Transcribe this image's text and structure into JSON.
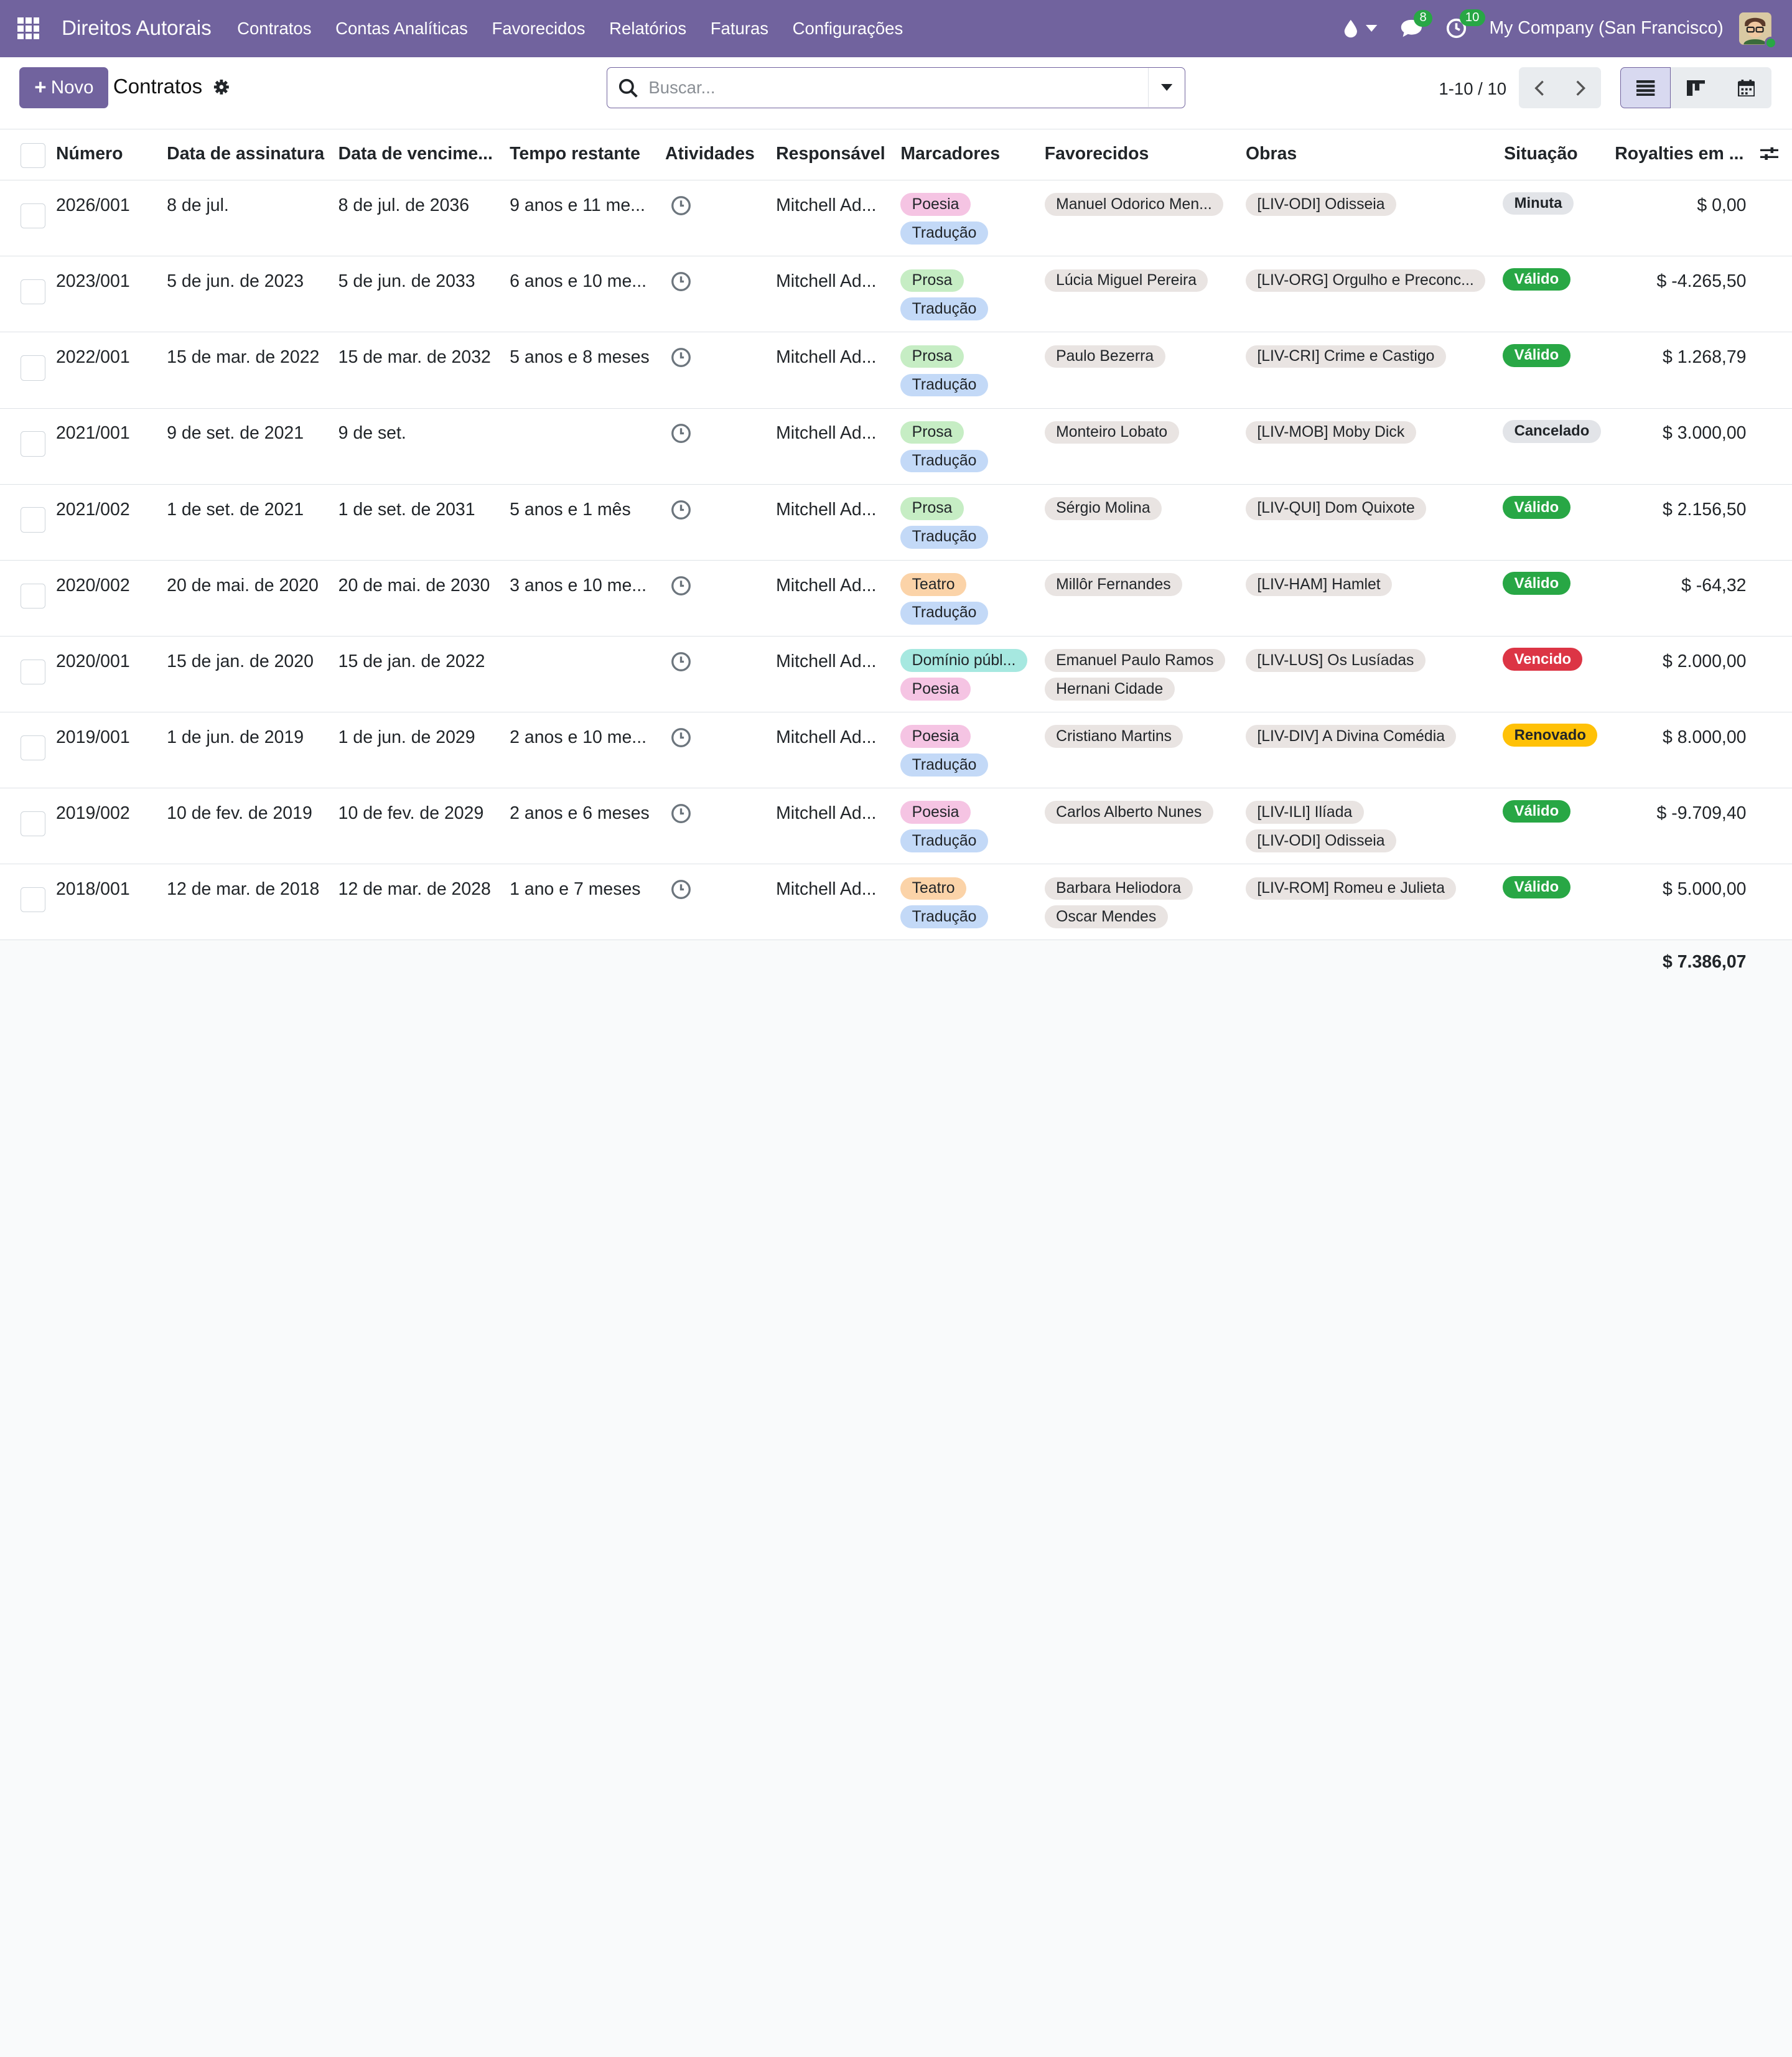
{
  "navbar": {
    "app_name": "Direitos Autorais",
    "menu": [
      "Contratos",
      "Contas Analíticas",
      "Favorecidos",
      "Relatórios",
      "Faturas",
      "Configurações"
    ],
    "messages_count": "8",
    "activities_count": "10",
    "company": "My Company (San Francisco)"
  },
  "control": {
    "new_label": "Novo",
    "title": "Contratos",
    "search_placeholder": "Buscar...",
    "pager": "1-10 / 10"
  },
  "columns": [
    "Número",
    "Data de assinatura",
    "Data de vencime...",
    "Tempo restante",
    "Atividades",
    "Responsável",
    "Marcadores",
    "Favorecidos",
    "Obras",
    "Situação",
    "Royalties em ..."
  ],
  "rows": [
    {
      "numero": "2026/001",
      "assinatura": "8 de jul.",
      "vencimento": "8 de jul. de 2036",
      "tempo": "9 anos e 11 me...",
      "responsavel": "Mitchell Ad...",
      "marcadores": [
        "Poesia",
        "Tradução"
      ],
      "favorecidos": [
        "Manuel Odorico Men..."
      ],
      "obras": [
        "[LIV-ODI] Odisseia"
      ],
      "situacao": "Minuta",
      "royalties": "$ 0,00"
    },
    {
      "numero": "2023/001",
      "assinatura": "5 de jun. de 2023",
      "vencimento": "5 de jun. de 2033",
      "tempo": "6 anos e 10 me...",
      "responsavel": "Mitchell Ad...",
      "marcadores": [
        "Prosa",
        "Tradução"
      ],
      "favorecidos": [
        "Lúcia Miguel Pereira"
      ],
      "obras": [
        "[LIV-ORG] Orgulho e Preconc..."
      ],
      "situacao": "Válido",
      "royalties": "$ -4.265,50"
    },
    {
      "numero": "2022/001",
      "assinatura": "15 de mar. de 2022",
      "vencimento": "15 de mar. de 2032",
      "tempo": "5 anos e 8 meses",
      "responsavel": "Mitchell Ad...",
      "marcadores": [
        "Prosa",
        "Tradução"
      ],
      "favorecidos": [
        "Paulo Bezerra"
      ],
      "obras": [
        "[LIV-CRI] Crime e Castigo"
      ],
      "situacao": "Válido",
      "royalties": "$ 1.268,79"
    },
    {
      "numero": "2021/001",
      "assinatura": "9 de set. de 2021",
      "vencimento": "9 de set.",
      "tempo": "",
      "responsavel": "Mitchell Ad...",
      "marcadores": [
        "Prosa",
        "Tradução"
      ],
      "favorecidos": [
        "Monteiro Lobato"
      ],
      "obras": [
        "[LIV-MOB] Moby Dick"
      ],
      "situacao": "Cancelado",
      "royalties": "$ 3.000,00"
    },
    {
      "numero": "2021/002",
      "assinatura": "1 de set. de 2021",
      "vencimento": "1 de set. de 2031",
      "tempo": "5 anos e 1 mês",
      "responsavel": "Mitchell Ad...",
      "marcadores": [
        "Prosa",
        "Tradução"
      ],
      "favorecidos": [
        "Sérgio Molina"
      ],
      "obras": [
        "[LIV-QUI] Dom Quixote"
      ],
      "situacao": "Válido",
      "royalties": "$ 2.156,50"
    },
    {
      "numero": "2020/002",
      "assinatura": "20 de mai. de 2020",
      "vencimento": "20 de mai. de 2030",
      "tempo": "3 anos e 10 me...",
      "responsavel": "Mitchell Ad...",
      "marcadores": [
        "Teatro",
        "Tradução"
      ],
      "favorecidos": [
        "Millôr Fernandes"
      ],
      "obras": [
        "[LIV-HAM] Hamlet"
      ],
      "situacao": "Válido",
      "royalties": "$ -64,32"
    },
    {
      "numero": "2020/001",
      "assinatura": "15 de jan. de 2020",
      "vencimento": "15 de jan. de 2022",
      "tempo": "",
      "responsavel": "Mitchell Ad...",
      "marcadores": [
        "Domínio públ...",
        "Poesia"
      ],
      "favorecidos": [
        "Emanuel Paulo Ramos",
        "Hernani Cidade"
      ],
      "obras": [
        "[LIV-LUS] Os Lusíadas"
      ],
      "situacao": "Vencido",
      "royalties": "$ 2.000,00"
    },
    {
      "numero": "2019/001",
      "assinatura": "1 de jun. de 2019",
      "vencimento": "1 de jun. de 2029",
      "tempo": "2 anos e 10 me...",
      "responsavel": "Mitchell Ad...",
      "marcadores": [
        "Poesia",
        "Tradução"
      ],
      "favorecidos": [
        "Cristiano Martins"
      ],
      "obras": [
        "[LIV-DIV] A Divina Comédia"
      ],
      "situacao": "Renovado",
      "royalties": "$ 8.000,00"
    },
    {
      "numero": "2019/002",
      "assinatura": "10 de fev. de 2019",
      "vencimento": "10 de fev. de 2029",
      "tempo": "2 anos e 6 meses",
      "responsavel": "Mitchell Ad...",
      "marcadores": [
        "Poesia",
        "Tradução"
      ],
      "favorecidos": [
        "Carlos Alberto Nunes"
      ],
      "obras": [
        "[LIV-ILI] Ilíada",
        "[LIV-ODI] Odisseia"
      ],
      "situacao": "Válido",
      "royalties": "$ -9.709,40"
    },
    {
      "numero": "2018/001",
      "assinatura": "12 de mar. de 2018",
      "vencimento": "12 de mar. de 2028",
      "tempo": "1 ano e 7 meses",
      "responsavel": "Mitchell Ad...",
      "marcadores": [
        "Teatro",
        "Tradução"
      ],
      "favorecidos": [
        "Barbara Heliodora",
        "Oscar Mendes"
      ],
      "obras": [
        "[LIV-ROM] Romeu e Julieta"
      ],
      "situacao": "Válido",
      "royalties": "$ 5.000,00"
    }
  ],
  "total": "$ 7.386,07",
  "colors": {
    "brand": "#71639e",
    "tag_poesia": "#f5c4e3",
    "tag_traducao": "#c3d9f7",
    "tag_prosa": "#c6edc4",
    "tag_teatro": "#fbd3a8",
    "tag_dominio": "#a6e8e0",
    "tag_neutral": "#e9e4e2",
    "status_valido": "#28a745",
    "status_minuta": "#e2e4e8",
    "status_cancelado": "#e2e4e8",
    "status_vencido": "#dc3545",
    "status_renovado": "#ffc107"
  },
  "icons": [
    "apps-grid-icon",
    "drop-icon",
    "chat-icon",
    "clock-icon",
    "gear-icon",
    "search-icon",
    "caret-down-icon",
    "chevron-left-icon",
    "chevron-right-icon",
    "list-view-icon",
    "kanban-view-icon",
    "calendar-view-icon",
    "sliders-icon"
  ]
}
